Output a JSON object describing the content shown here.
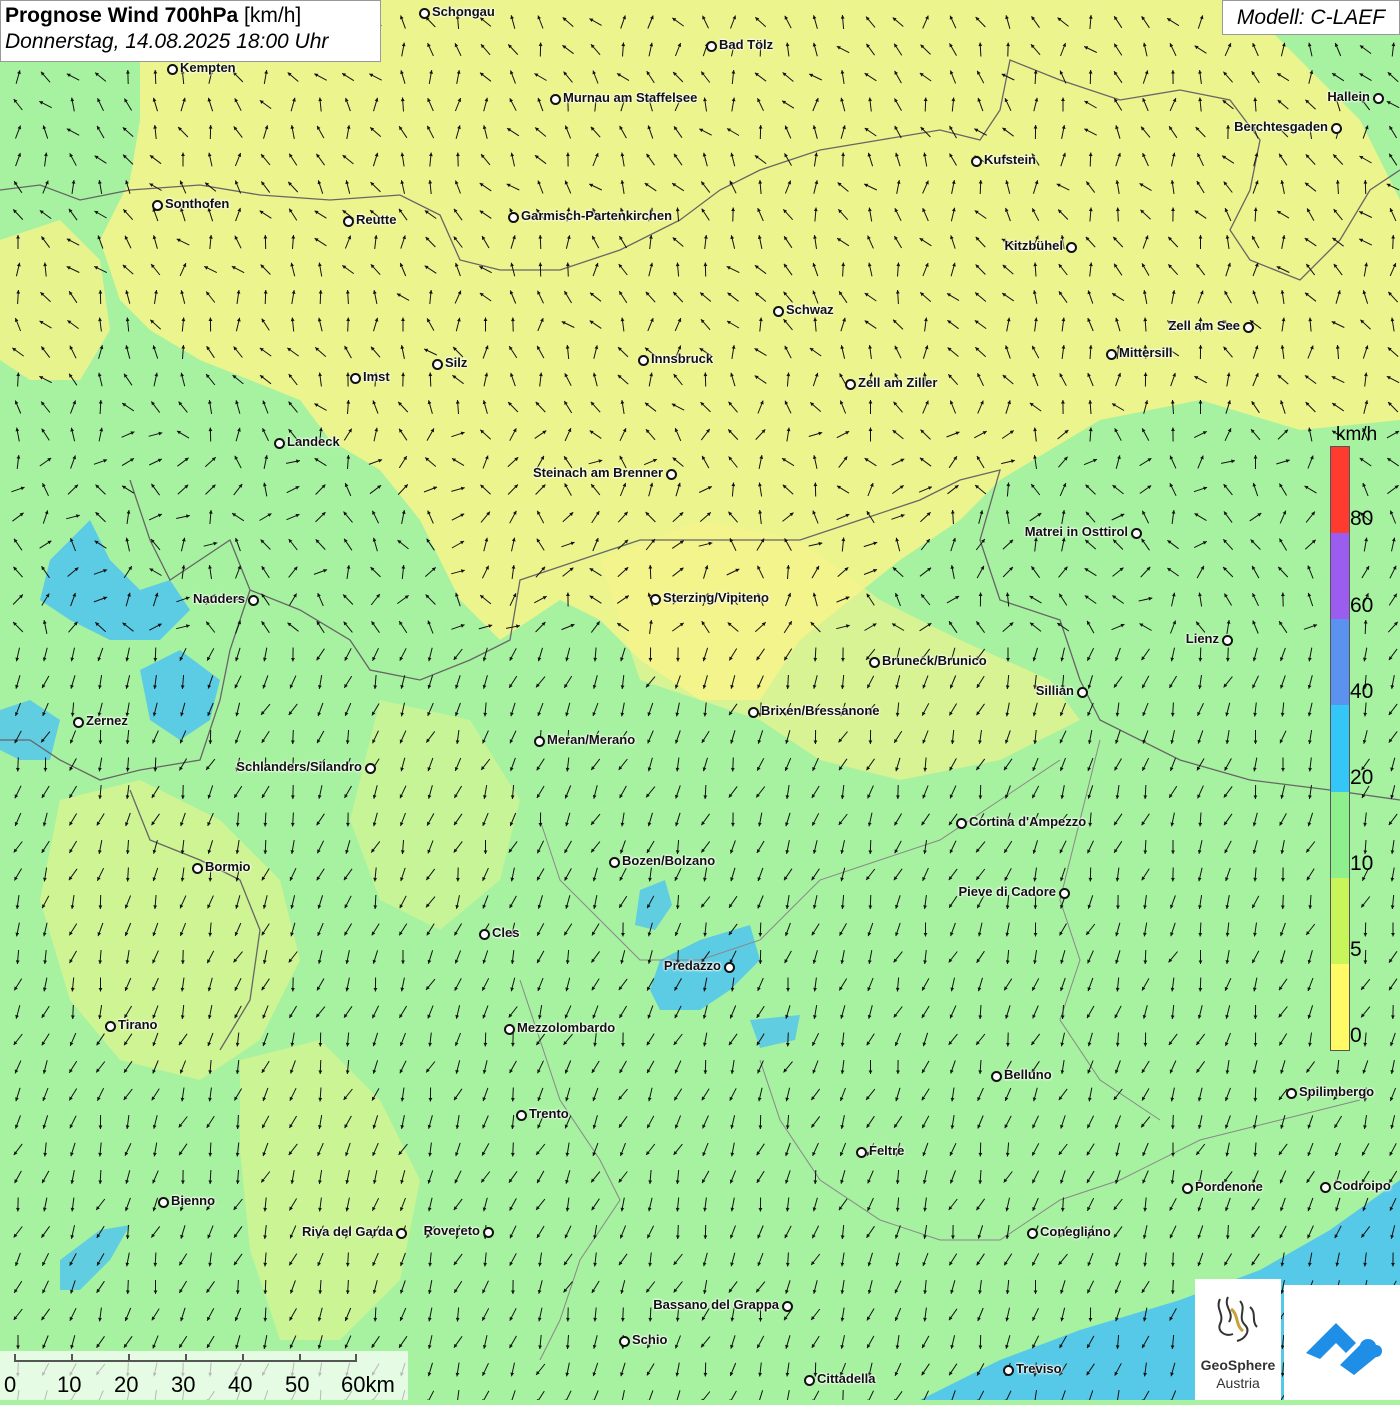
{
  "header": {
    "title_bold": "Prognose Wind 700hPa",
    "title_unit": "[km/h]",
    "datetime": "Donnerstag, 14.08.2025 18:00 Uhr"
  },
  "model": "Modell: C-LAEF",
  "legend": {
    "unit": "km/h",
    "ticks": [
      "80",
      "60",
      "40",
      "20",
      "10",
      "5",
      "0"
    ],
    "colors": [
      "#ff3a2e",
      "#9b5cf0",
      "#5b92f0",
      "#33c6f6",
      "#8ef08c",
      "#c8f65a",
      "#fffa66"
    ]
  },
  "scale_bar": {
    "labels": [
      "0",
      "10",
      "20",
      "30",
      "40",
      "50",
      "60km"
    ]
  },
  "logo": {
    "line1": "GeoSphere",
    "line2": "Austria"
  },
  "colors": {
    "calm_yellow": "#f8f48a",
    "light_green": "#a7f2a0",
    "blue_zone": "#4fc4f0",
    "border": "#666666"
  },
  "cities": [
    {
      "name": "Schongau"
    },
    {
      "name": "Bad Tölz"
    },
    {
      "name": "Kempten"
    },
    {
      "name": "Murnau am Staffelsee"
    },
    {
      "name": "Hallein"
    },
    {
      "name": "Berchtesgaden"
    },
    {
      "name": "Kufstein"
    },
    {
      "name": "Sonthofen"
    },
    {
      "name": "Reutte"
    },
    {
      "name": "Garmisch-Partenkirchen"
    },
    {
      "name": "Kitzbühel"
    },
    {
      "name": "Schwaz"
    },
    {
      "name": "Zell am See"
    },
    {
      "name": "Mittersill"
    },
    {
      "name": "Silz"
    },
    {
      "name": "Imst"
    },
    {
      "name": "Innsbruck"
    },
    {
      "name": "Zell am Ziller"
    },
    {
      "name": "Landeck"
    },
    {
      "name": "Steinach am Brenner"
    },
    {
      "name": "Matrei in Osttirol"
    },
    {
      "name": "Nauders"
    },
    {
      "name": "Sterzing/Vipiteno"
    },
    {
      "name": "Lienz"
    },
    {
      "name": "Bruneck/Brunico"
    },
    {
      "name": "Sillian"
    },
    {
      "name": "Zernez"
    },
    {
      "name": "Brixen/Bressanone"
    },
    {
      "name": "Meran/Merano"
    },
    {
      "name": "Schlanders/Silandro"
    },
    {
      "name": "Cortina d'Ampezzo"
    },
    {
      "name": "Bozen/Bolzano"
    },
    {
      "name": "Bormio"
    },
    {
      "name": "Pieve di Cadore"
    },
    {
      "name": "Cles"
    },
    {
      "name": "Predazzo"
    },
    {
      "name": "Tirano"
    },
    {
      "name": "Mezzolombardo"
    },
    {
      "name": "Belluno"
    },
    {
      "name": "Spilimbergo"
    },
    {
      "name": "Trento"
    },
    {
      "name": "Feltre"
    },
    {
      "name": "Pordenone"
    },
    {
      "name": "Codroipo"
    },
    {
      "name": "Bienno"
    },
    {
      "name": "Riva del Garda"
    },
    {
      "name": "Rovereto"
    },
    {
      "name": "Conegliano"
    },
    {
      "name": "Bassano del Grappa"
    },
    {
      "name": "Schio"
    },
    {
      "name": "Treviso"
    },
    {
      "name": "Cittadella"
    }
  ]
}
